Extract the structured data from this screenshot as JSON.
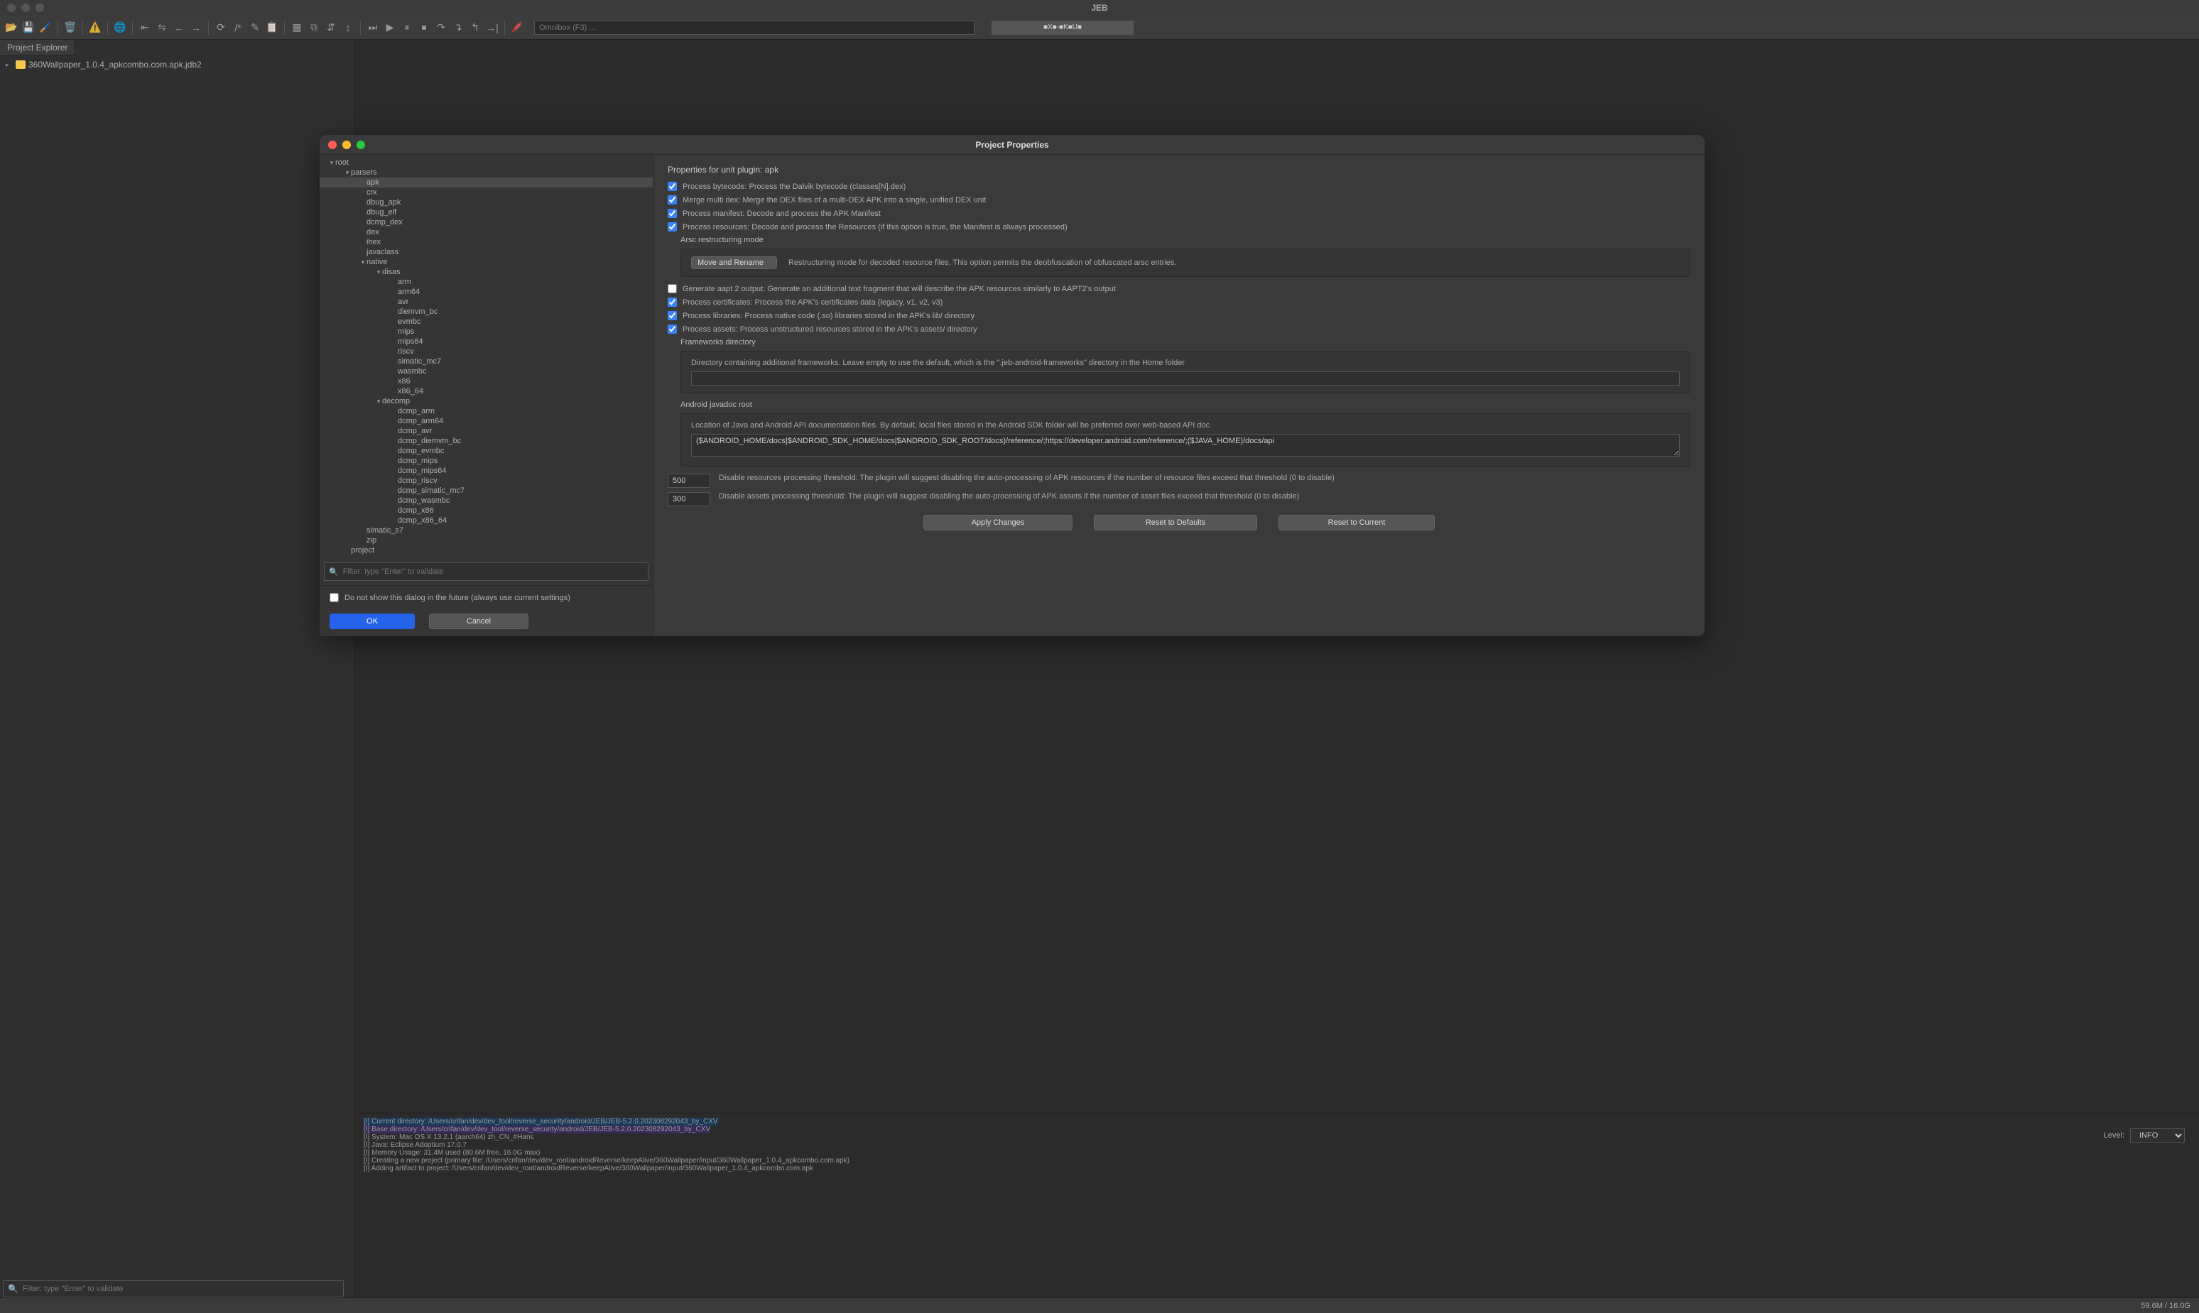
{
  "titlebar": {
    "title": "JEB"
  },
  "toolbar": {
    "omnibox_placeholder": "Omnibox (F3) ...",
    "right_text": "■X■-■K■U■"
  },
  "sidebar": {
    "tab": "Project Explorer",
    "root_item": "360Wallpaper_1.0.4_apkcombo.com.apk.jdb2"
  },
  "bottom_filter_placeholder": "Filter: type \"Enter\" to validate",
  "dialog": {
    "title": "Project Properties",
    "tree": [
      {
        "label": "root",
        "depth": 0,
        "expand": "▾"
      },
      {
        "label": "parsers",
        "depth": 1,
        "expand": "▾"
      },
      {
        "label": "apk",
        "depth": 2,
        "expand": "",
        "selected": true
      },
      {
        "label": "crx",
        "depth": 2,
        "expand": ""
      },
      {
        "label": "dbug_apk",
        "depth": 2,
        "expand": ""
      },
      {
        "label": "dbug_elf",
        "depth": 2,
        "expand": ""
      },
      {
        "label": "dcmp_dex",
        "depth": 2,
        "expand": ""
      },
      {
        "label": "dex",
        "depth": 2,
        "expand": ""
      },
      {
        "label": "ihex",
        "depth": 2,
        "expand": ""
      },
      {
        "label": "javaclass",
        "depth": 2,
        "expand": ""
      },
      {
        "label": "native",
        "depth": 2,
        "expand": "▾"
      },
      {
        "label": "disas",
        "depth": 3,
        "expand": "▾"
      },
      {
        "label": "arm",
        "depth": 4,
        "expand": ""
      },
      {
        "label": "arm64",
        "depth": 4,
        "expand": ""
      },
      {
        "label": "avr",
        "depth": 4,
        "expand": ""
      },
      {
        "label": "diemvm_bc",
        "depth": 4,
        "expand": ""
      },
      {
        "label": "evmbc",
        "depth": 4,
        "expand": ""
      },
      {
        "label": "mips",
        "depth": 4,
        "expand": ""
      },
      {
        "label": "mips64",
        "depth": 4,
        "expand": ""
      },
      {
        "label": "riscv",
        "depth": 4,
        "expand": ""
      },
      {
        "label": "simatic_mc7",
        "depth": 4,
        "expand": ""
      },
      {
        "label": "wasmbc",
        "depth": 4,
        "expand": ""
      },
      {
        "label": "x86",
        "depth": 4,
        "expand": ""
      },
      {
        "label": "x86_64",
        "depth": 4,
        "expand": ""
      },
      {
        "label": "decomp",
        "depth": 3,
        "expand": "▾"
      },
      {
        "label": "dcmp_arm",
        "depth": 4,
        "expand": ""
      },
      {
        "label": "dcmp_arm64",
        "depth": 4,
        "expand": ""
      },
      {
        "label": "dcmp_avr",
        "depth": 4,
        "expand": ""
      },
      {
        "label": "dcmp_diemvm_bc",
        "depth": 4,
        "expand": ""
      },
      {
        "label": "dcmp_evmbc",
        "depth": 4,
        "expand": ""
      },
      {
        "label": "dcmp_mips",
        "depth": 4,
        "expand": ""
      },
      {
        "label": "dcmp_mips64",
        "depth": 4,
        "expand": ""
      },
      {
        "label": "dcmp_riscv",
        "depth": 4,
        "expand": ""
      },
      {
        "label": "dcmp_simatic_mc7",
        "depth": 4,
        "expand": ""
      },
      {
        "label": "dcmp_wasmbc",
        "depth": 4,
        "expand": ""
      },
      {
        "label": "dcmp_x86",
        "depth": 4,
        "expand": ""
      },
      {
        "label": "dcmp_x86_64",
        "depth": 4,
        "expand": ""
      },
      {
        "label": "simatic_s7",
        "depth": 2,
        "expand": ""
      },
      {
        "label": "zip",
        "depth": 2,
        "expand": ""
      },
      {
        "label": "project",
        "depth": 1,
        "expand": ""
      }
    ],
    "filter_placeholder": "Filter: type \"Enter\" to validate",
    "right": {
      "heading": "Properties for unit plugin: apk",
      "chk_bytecode": "Process bytecode: Process the Dalvik bytecode (classes[N].dex)",
      "chk_merge": "Merge multi dex: Merge the DEX files of a multi-DEX APK into a single, unified DEX unit",
      "chk_manifest": "Process manifest: Decode and process the APK Manifest",
      "chk_resources": "Process resources: Decode and process the Resources (if this option is true, the Manifest is always processed)",
      "arsc_label": "Arsc restructuring mode",
      "arsc_select": "Move and Rename",
      "arsc_desc": "Restructuring mode for decoded resource files. This option permits the deobfuscation of obfuscated arsc entries.",
      "chk_aapt": "Generate aapt 2 output: Generate an additional text fragment that will describe the APK resources similarly to AAPT2's output",
      "chk_certs": "Process certificates: Process the APK's certificates data (legacy, v1, v2, v3)",
      "chk_libs": "Process libraries: Process native code (.so) libraries stored in the APK's lib/ directory",
      "chk_assets": "Process assets: Process unstructured resources stored in the APK's assets/ directory",
      "frameworks_label": "Frameworks directory",
      "frameworks_desc": "Directory containing additional frameworks. Leave empty to use the default, which is the \".jeb-android-frameworks\" directory in the Home folder",
      "frameworks_value": "",
      "javadoc_label": "Android javadoc root",
      "javadoc_desc": "Location of Java and Android API documentation files. By default, local files stored in the Android SDK folder will be preferred over web-based API doc",
      "javadoc_value": "($ANDROID_HOME/docs|$ANDROID_SDK_HOME/docs|$ANDROID_SDK_ROOT/docs)/reference/;https://developer.android.com/reference/;($JAVA_HOME)/docs/api",
      "res_threshold_num": "500",
      "res_threshold_desc": "Disable resources processing threshold: The plugin will suggest disabling the auto-processing of APK resources if the number of resource files exceed that threshold (0 to disable)",
      "assets_threshold_num": "300",
      "assets_threshold_desc": "Disable assets processing threshold: The plugin will suggest disabling the auto-processing of APK assets if the number of asset files exceed that threshold (0 to disable)",
      "btn_apply": "Apply Changes",
      "btn_defaults": "Reset to Defaults",
      "btn_current": "Reset to Current"
    },
    "footer": {
      "chk_noshow": "Do not show this dialog in the future (always use current settings)",
      "btn_ok": "OK",
      "btn_cancel": "Cancel"
    }
  },
  "console": {
    "level_label": "Level:",
    "level_value": "INFO",
    "lines": [
      "[I] Current directory: /Users/crifan/dev/dev_tool/reverse_security/android/JEB/JEB-5.2.0.202308292043_by_CXV",
      "[I] Base directory: /Users/crifan/dev/dev_tool/reverse_security/android/JEB/JEB-5.2.0.202308292043_by_CXV",
      "[I] System: Mac OS X 13.2.1 (aarch64) zh_CN_#Hans",
      "[I] Java: Eclipse Adoptium 17.0.7",
      "[I] Memory Usage: 31.4M used (80.6M free, 16.0G max)",
      "[I] Creating a new project (primary file: /Users/crifan/dev/dev_root/androidReverse/keepAlive/360Wallpaper/input/360Wallpaper_1.0.4_apkcombo.com.apk)",
      "[I] Adding artifact to project: /Users/crifan/dev/dev_root/androidReverse/keepAlive/360Wallpaper/input/360Wallpaper_1.0.4_apkcombo.com.apk"
    ]
  },
  "statusbar": {
    "memory": "59.6M / 16.0G"
  }
}
